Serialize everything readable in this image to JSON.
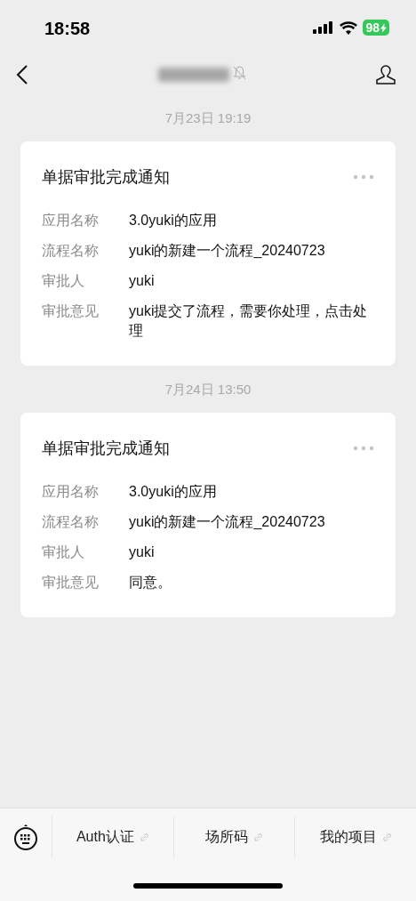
{
  "status_bar": {
    "time": "18:58",
    "battery": "98"
  },
  "header": {
    "muted": true
  },
  "messages": [
    {
      "timestamp": "7月23日 19:19",
      "card": {
        "title": "单据审批完成通知",
        "fields": [
          {
            "label": "应用名称",
            "value": "3.0yuki的应用"
          },
          {
            "label": "流程名称",
            "value": "yuki的新建一个流程_20240723"
          },
          {
            "label": "审批人",
            "value": "yuki"
          },
          {
            "label": "审批意见",
            "value": "yuki提交了流程，需要你处理，点击处理"
          }
        ]
      }
    },
    {
      "timestamp": "7月24日 13:50",
      "card": {
        "title": "单据审批完成通知",
        "fields": [
          {
            "label": "应用名称",
            "value": "3.0yuki的应用"
          },
          {
            "label": "流程名称",
            "value": "yuki的新建一个流程_20240723"
          },
          {
            "label": "审批人",
            "value": "yuki"
          },
          {
            "label": "审批意见",
            "value": "同意。"
          }
        ]
      }
    }
  ],
  "menu_bar": {
    "items": [
      {
        "label": "Auth认证"
      },
      {
        "label": "场所码"
      },
      {
        "label": "我的项目"
      }
    ]
  }
}
